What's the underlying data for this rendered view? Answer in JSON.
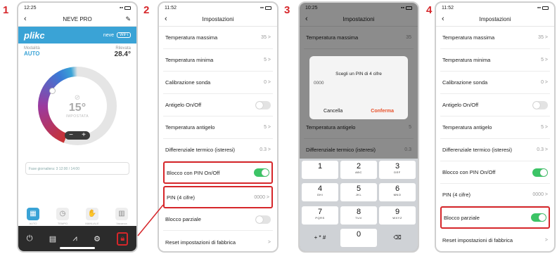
{
  "steps": [
    "1",
    "2",
    "3",
    "4"
  ],
  "phone1": {
    "time": "12:25",
    "nav_title": "NEVE PRO",
    "logo": "plikc",
    "device_name": "neve",
    "wifi_badge": "WiFi",
    "mode_label": "Modalità",
    "mode_value": "AUTO",
    "measured_label": "Rilevata",
    "measured_value": "28.4°",
    "set_temp": "15°",
    "set_label": "IMPOSTATA",
    "minus": "−",
    "plus": "+",
    "schedule": "Fase giornaliera: 3 12:00 / 14:00",
    "tabs": [
      {
        "label": "AUTO",
        "icon": "calendar-icon"
      },
      {
        "label": "TEMPO",
        "icon": "timer-icon"
      },
      {
        "label": "MANUALE",
        "icon": "hand-icon"
      },
      {
        "label": "Vacanza",
        "icon": "suitcase-icon"
      }
    ],
    "bottom_icons": [
      "power-icon",
      "calendar-icon",
      "chart-icon",
      "gear-icon",
      "lock-icon"
    ]
  },
  "phone2": {
    "time": "11:52",
    "nav_title": "Impostazioni",
    "rows": [
      {
        "label": "Temperatura massima",
        "value": "35 >"
      },
      {
        "label": "Temperatura minima",
        "value": "5 >"
      },
      {
        "label": "Calibrazione sonda",
        "value": "0 >"
      },
      {
        "label": "Antigelo On/Off",
        "value": ""
      },
      {
        "label": "Temperatura antigelo",
        "value": "5 >"
      },
      {
        "label": "Differenziale termico (isteresi)",
        "value": "0.3 >"
      },
      {
        "label": "Blocco con PIN On/Off",
        "value": ""
      },
      {
        "label": "PIN (4 cifre)",
        "value": "0000 >"
      },
      {
        "label": "Blocco parziale",
        "value": ""
      },
      {
        "label": "Reset impostazioni di fabbrica",
        "value": ">"
      }
    ]
  },
  "phone3": {
    "time": "10:25",
    "nav_title": "Impostazioni",
    "bg_rows": [
      {
        "label": "Temperatura massima",
        "value": "35"
      },
      {
        "label": "Temperatura antigelo",
        "value": "5"
      },
      {
        "label": "Differenziale termico (isteresi)",
        "value": "0.3"
      }
    ],
    "dialog_title": "Scegli un PIN di 4 cifre",
    "dialog_value": "0000",
    "cancel": "Cancella",
    "confirm": "Conferma",
    "keys": [
      {
        "n": "1",
        "l": ""
      },
      {
        "n": "2",
        "l": "ABC"
      },
      {
        "n": "3",
        "l": "DEF"
      },
      {
        "n": "4",
        "l": "GHI"
      },
      {
        "n": "5",
        "l": "JKL"
      },
      {
        "n": "6",
        "l": "MNO"
      },
      {
        "n": "7",
        "l": "PQRS"
      },
      {
        "n": "8",
        "l": "TUV"
      },
      {
        "n": "9",
        "l": "WXYZ"
      },
      {
        "n": "+ * #",
        "l": ""
      },
      {
        "n": "0",
        "l": ""
      },
      {
        "n": "⌫",
        "l": ""
      }
    ]
  },
  "phone4": {
    "time": "11:52",
    "nav_title": "Impostazioni",
    "rows": [
      {
        "label": "Temperatura massima",
        "value": "35 >"
      },
      {
        "label": "Temperatura minima",
        "value": "5 >"
      },
      {
        "label": "Calibrazione sonda",
        "value": "0 >"
      },
      {
        "label": "Antigelo On/Off",
        "value": ""
      },
      {
        "label": "Temperatura antigelo",
        "value": "5 >"
      },
      {
        "label": "Differenziale termico (isteresi)",
        "value": "0.3 >"
      },
      {
        "label": "Blocco con PIN On/Off",
        "value": ""
      },
      {
        "label": "PIN (4 cifre)",
        "value": "0000 >"
      },
      {
        "label": "Blocco parziale",
        "value": ""
      },
      {
        "label": "Reset impostazioni di fabbrica",
        "value": ">"
      }
    ]
  },
  "colors": {
    "accent": "#3aa3d6",
    "highlight": "#d6262a",
    "toggle_on": "#3cc466",
    "confirm": "#e8512a"
  }
}
